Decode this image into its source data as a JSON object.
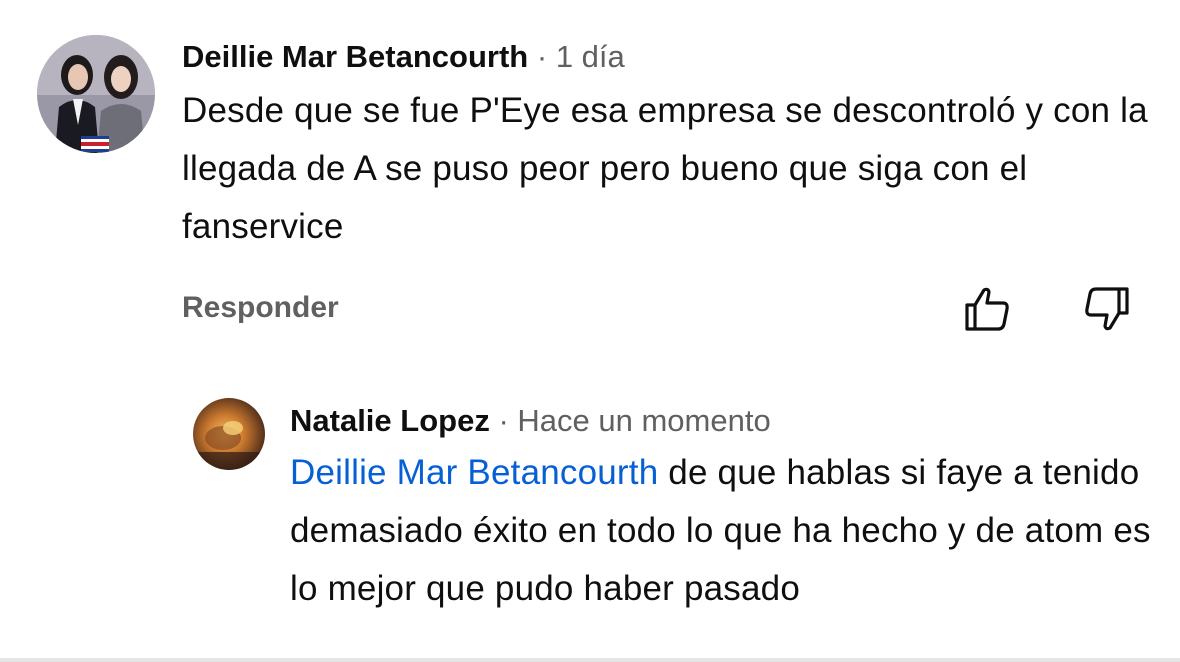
{
  "comment": {
    "author": "Deillie Mar Betancourth",
    "separator": "·",
    "time": "1 día",
    "text": "Desde que se fue P'Eye esa empresa se descontroló y con la llegada de A se puso peor pero bueno que siga con el fanservice",
    "reply_label": "Responder",
    "like_icon": "thumbs-up-icon",
    "dislike_icon": "thumbs-down-icon"
  },
  "reply": {
    "author": "Natalie Lopez",
    "separator": "·",
    "time": "Hace un momento",
    "mention": "Deillie Mar Betancourth",
    "text": " de que hablas si faye a tenido demasiado éxito en todo lo que ha hecho y de atom es lo mejor que pudo haber pasado"
  },
  "colors": {
    "mention": "#065fd4",
    "secondary_text": "#606060",
    "primary_text": "#0f0f0f"
  }
}
